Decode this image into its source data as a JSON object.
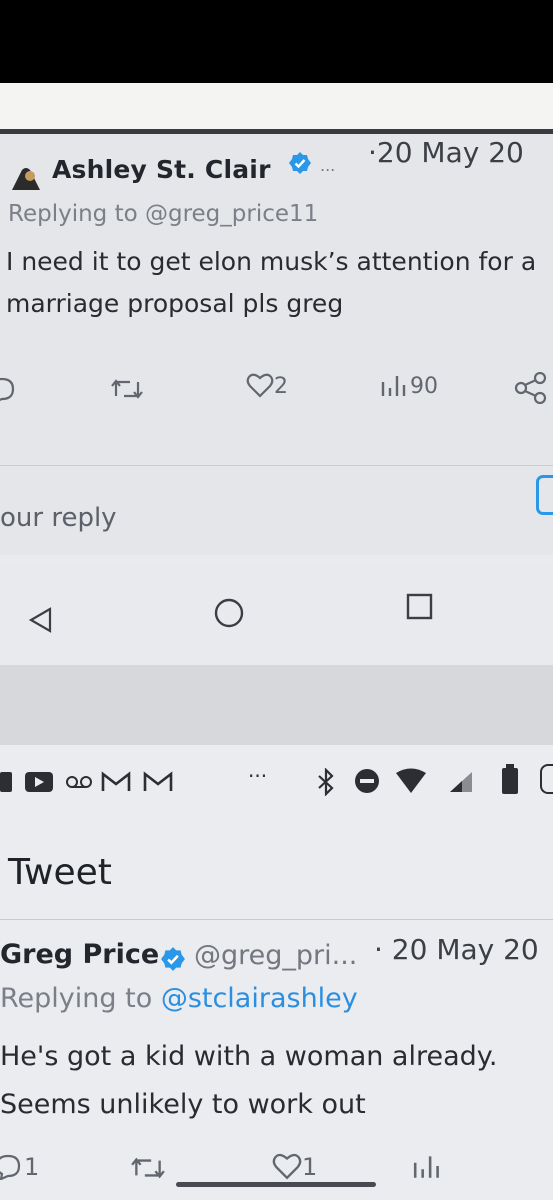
{
  "tweet1": {
    "author": "Ashley St. Clair",
    "ellipsis": "...",
    "date": "·20 May 20",
    "replying": "Replying to @greg_price11",
    "text": "I need it to get elon musk’s attention for a marriage proposal pls greg",
    "likes": "2",
    "views": "90"
  },
  "reply_box": {
    "placeholder": "our reply"
  },
  "screen2": {
    "statusbar_more": "···",
    "page_title": "Tweet",
    "tweet": {
      "author": "Greg Price",
      "handle": "@greg_pri...",
      "date": "· 20 May 20",
      "replying_prefix": "Replying to ",
      "replying_handle": "@stclairashley",
      "text": "He's got a kid with a woman already. Seems unlikely to work out",
      "replies": "1",
      "likes": "1"
    }
  },
  "colors": {
    "accent": "#2b97e8",
    "verified": "#2b97e8"
  }
}
